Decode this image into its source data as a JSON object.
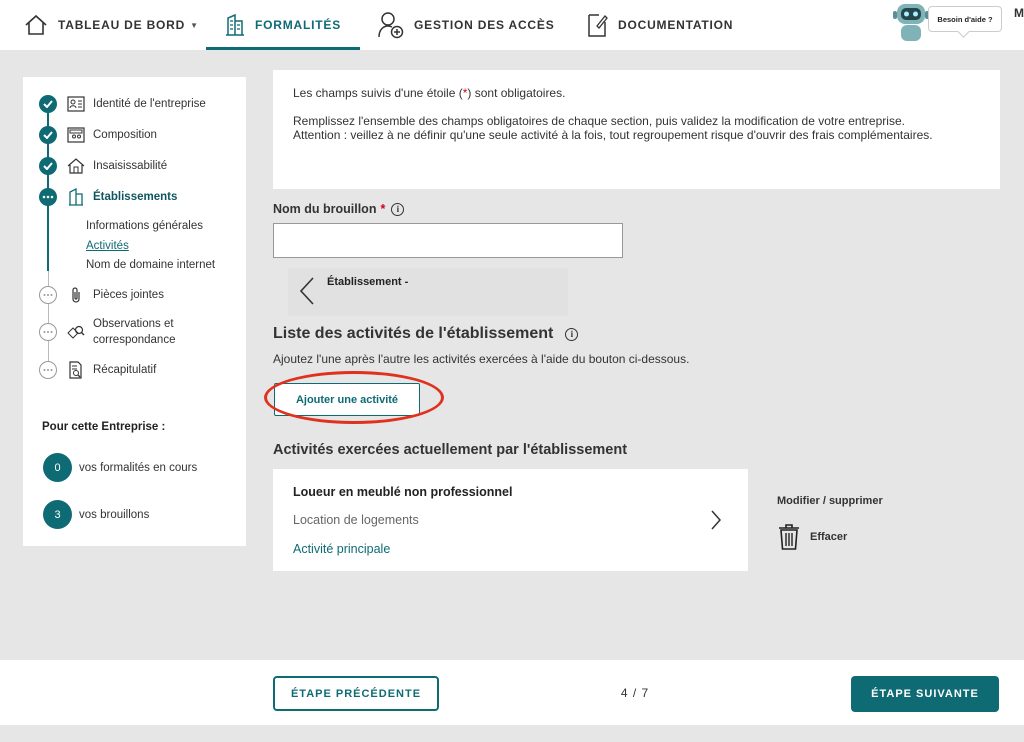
{
  "nav": {
    "dashboard": "TABLEAU DE BORD",
    "formalites": "FORMALITÉS",
    "access": "GESTION DES ACCÈS",
    "documentation": "DOCUMENTATION",
    "help": "Besoin d'aide ?",
    "cut_text": "M"
  },
  "sidebar": {
    "steps": [
      {
        "label": "Identité de l'entreprise",
        "state": "done",
        "icon": "id-card-icon"
      },
      {
        "label": "Composition",
        "state": "done",
        "icon": "people-card-icon"
      },
      {
        "label": "Insaisissabilité",
        "state": "done",
        "icon": "house-icon"
      },
      {
        "label": "Établissements",
        "state": "current",
        "icon": "building-icon"
      },
      {
        "label": "Pièces jointes",
        "state": "todo",
        "icon": "paperclip-icon"
      },
      {
        "label": "Observations et correspondance",
        "state": "todo",
        "icon": "chat-search-icon"
      },
      {
        "label": "Récapitulatif",
        "state": "todo",
        "icon": "document-search-icon"
      }
    ],
    "substeps": [
      {
        "label": "Informations générales",
        "active": false
      },
      {
        "label": "Activités",
        "active": true
      },
      {
        "label": "Nom de domaine internet",
        "active": false
      }
    ],
    "company_title": "Pour cette Entreprise :",
    "counters": [
      {
        "value": "0",
        "label": "vos formalités en cours"
      },
      {
        "value": "3",
        "label": "vos brouillons"
      }
    ]
  },
  "main": {
    "info_line1_prefix": "Les champs suivis d'une étoile (",
    "info_star": "*",
    "info_line1_suffix": ") sont obligatoires.",
    "info_line2": "Remplissez l'ensemble des champs obligatoires de chaque section, puis validez la modification de votre entreprise.",
    "info_line3": "Attention : veillez à ne définir qu'une seule activité à la fois, tout regroupement risque d'ouvrir des frais complémentaires.",
    "draft_label": "Nom du brouillon",
    "required_star": "*",
    "draft_value": "",
    "establishment_title": "Établissement -",
    "activities_title": "Liste des activités de l'établissement",
    "activities_subtitle": "Ajoutez l'une après l'autre les activités exercées à l'aide du bouton ci-dessous.",
    "add_button": "Ajouter une activité",
    "current_title": "Activités exercées actuellement par l'établissement",
    "activity": {
      "name": "Loueur en meublé non professionnel",
      "description": "Location de logements",
      "type": "Activité principale"
    },
    "modify_label": "Modifier / supprimer",
    "delete_label": "Effacer"
  },
  "footer": {
    "prev": "ÉTAPE PRÉCÉDENTE",
    "pager": "4 / 7",
    "next": "ÉTAPE SUIVANTE"
  },
  "colors": {
    "accent": "#0e6b74",
    "required": "#d2001a",
    "highlight": "#e0301e",
    "background": "#e6e6e6"
  }
}
